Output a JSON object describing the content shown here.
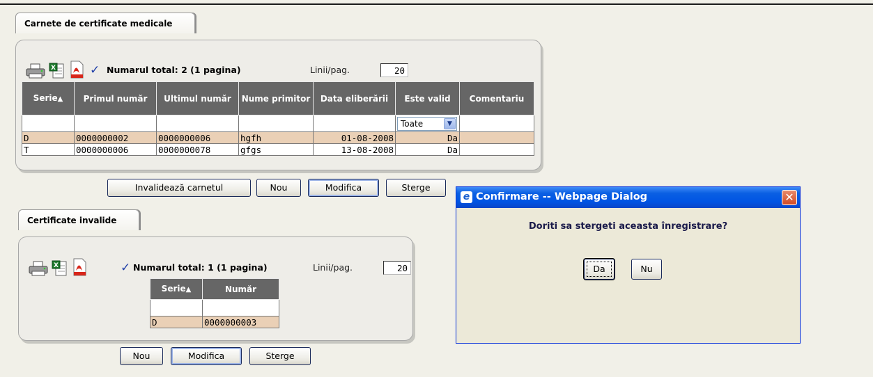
{
  "section1": {
    "tab_label": "Carnete de certificate medicale",
    "toolbar": {
      "icons": [
        "printer-icon",
        "excel-icon",
        "pdf-icon",
        "check-icon"
      ],
      "total_text": "Numarul total: 2 (1 pagina)",
      "lines_label": "Linii/pag.",
      "lines_value": "20"
    },
    "columns": [
      "Serie",
      "Primul număr",
      "Ultimul număr",
      "Nume primitor",
      "Data eliberării",
      "Este valid",
      "Comentariu"
    ],
    "valid_filter": "Toate",
    "rows": [
      {
        "serie": "D",
        "primul": "0000000002",
        "ultimul": "0000000006",
        "nume": "hgfh",
        "data": "01-08-2008",
        "valid": "Da",
        "comentariu": ""
      },
      {
        "serie": "T",
        "primul": "0000000006",
        "ultimul": "0000000078",
        "nume": "gfgs",
        "data": "13-08-2008",
        "valid": "Da",
        "comentariu": ""
      }
    ],
    "buttons": {
      "invalideaza": "Invalidează carnetul",
      "nou": "Nou",
      "modifica": "Modifica",
      "sterge": "Sterge"
    }
  },
  "section2": {
    "tab_label": "Certificate invalide",
    "toolbar": {
      "total_text": "Numarul total: 1 (1 pagina)",
      "lines_label": "Linii/pag.",
      "lines_value": "20"
    },
    "columns": [
      "Serie",
      "Număr"
    ],
    "rows": [
      {
        "serie": "D",
        "numar": "0000000003"
      }
    ],
    "buttons": {
      "nou": "Nou",
      "modifica": "Modifica",
      "sterge": "Sterge"
    }
  },
  "dialog": {
    "title": "Confirmare -- Webpage Dialog",
    "message": "Doriti sa stergeti aceasta înregistrare?",
    "yes_label": "Da",
    "no_label": "Nu"
  }
}
